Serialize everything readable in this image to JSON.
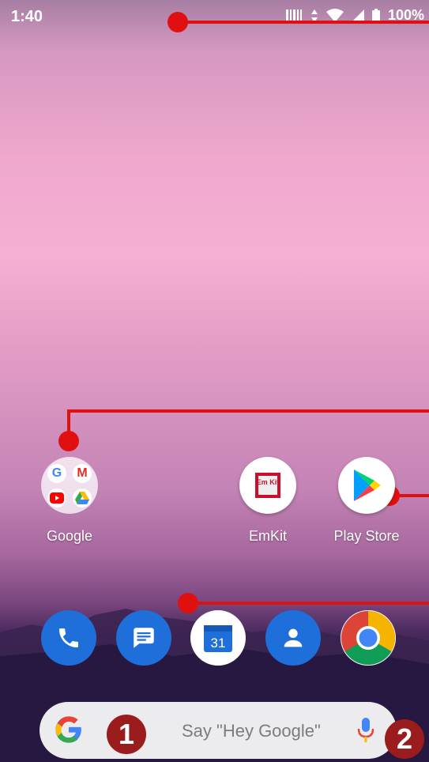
{
  "status_bar": {
    "time": "1:40",
    "battery_text": "100%"
  },
  "apps": {
    "google_folder_label": "Google",
    "emkit_label": "EmKit",
    "playstore_label": "Play Store",
    "emkit_logo_text": "Em Kit"
  },
  "dock": {
    "calendar_day": "31"
  },
  "search": {
    "placeholder": "Say \"Hey Google\""
  },
  "annotations": {
    "badge_1": "1",
    "badge_2": "2"
  },
  "colors": {
    "annotation_red": "#e01010",
    "badge_red": "#9b1c1c",
    "dock_blue": "#1e6fd9"
  },
  "icons": [
    "barcode-icon",
    "data-arrows-icon",
    "wifi-icon",
    "signal-icon",
    "battery-icon",
    "phone-icon",
    "messages-icon",
    "calendar-icon",
    "contacts-icon",
    "chrome-icon",
    "google-g-icon",
    "mic-icon",
    "play-store-icon"
  ]
}
